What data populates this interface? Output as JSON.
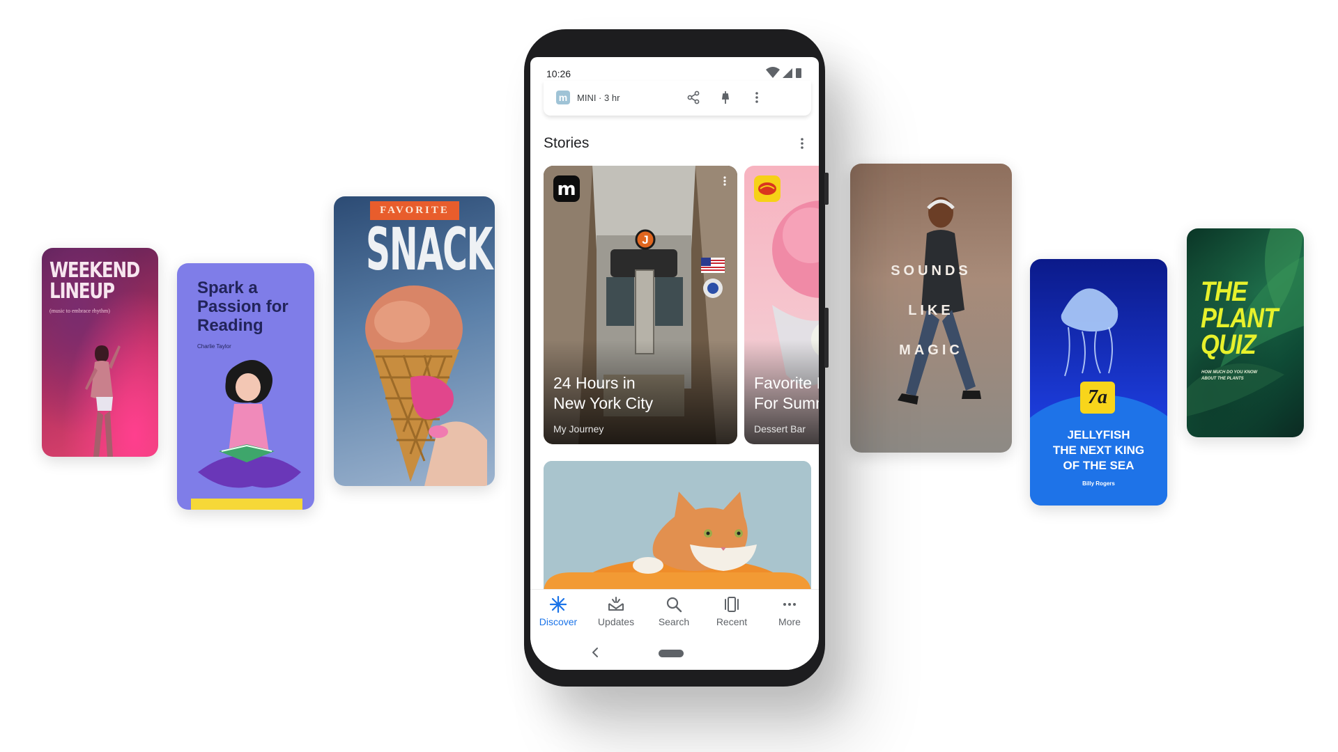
{
  "cards": {
    "weekend": {
      "title": "WEEKEND\nLINEUP",
      "subtitle": "(music to embrace rhythm)"
    },
    "reading": {
      "title": "Spark a Passion for Reading",
      "author": "Charlie Taylor"
    },
    "snack": {
      "tag": "FAVORITE",
      "title": "SNACK"
    },
    "magic": {
      "title": "SOUNDS\nLIKE\nMAGIC"
    },
    "jelly": {
      "logo": "7a",
      "title": "JELLYFISH\nTHE NEXT KING\nOF THE SEA",
      "author": "Billy Rogers"
    },
    "plant": {
      "title": "THE\nPLANT\nQUIZ",
      "subtitle": "HOW MUCH DO YOU KNOW\nABOUT THE PLANTS"
    }
  },
  "phone": {
    "status": {
      "time": "10:26"
    },
    "mini_card": {
      "logo": "m",
      "source": "MINI · 3 hr"
    },
    "stories": {
      "title": "Stories",
      "items": [
        {
          "title": "24 Hours in\nNew York City",
          "source": "My Journey",
          "logo": "m",
          "train_sign": "J"
        },
        {
          "title": "Favorite Ic\nFor Summ",
          "source": "Dessert Bar"
        }
      ]
    },
    "bottom_nav": [
      {
        "label": "Discover",
        "icon": "discover-icon",
        "active": true
      },
      {
        "label": "Updates",
        "icon": "updates-icon",
        "active": false
      },
      {
        "label": "Search",
        "icon": "search-icon",
        "active": false
      },
      {
        "label": "Recent",
        "icon": "recent-icon",
        "active": false
      },
      {
        "label": "More",
        "icon": "more-icon",
        "active": false
      }
    ]
  },
  "colors": {
    "accent": "#1a73e8",
    "text": "#202124",
    "muted": "#5f6368"
  }
}
